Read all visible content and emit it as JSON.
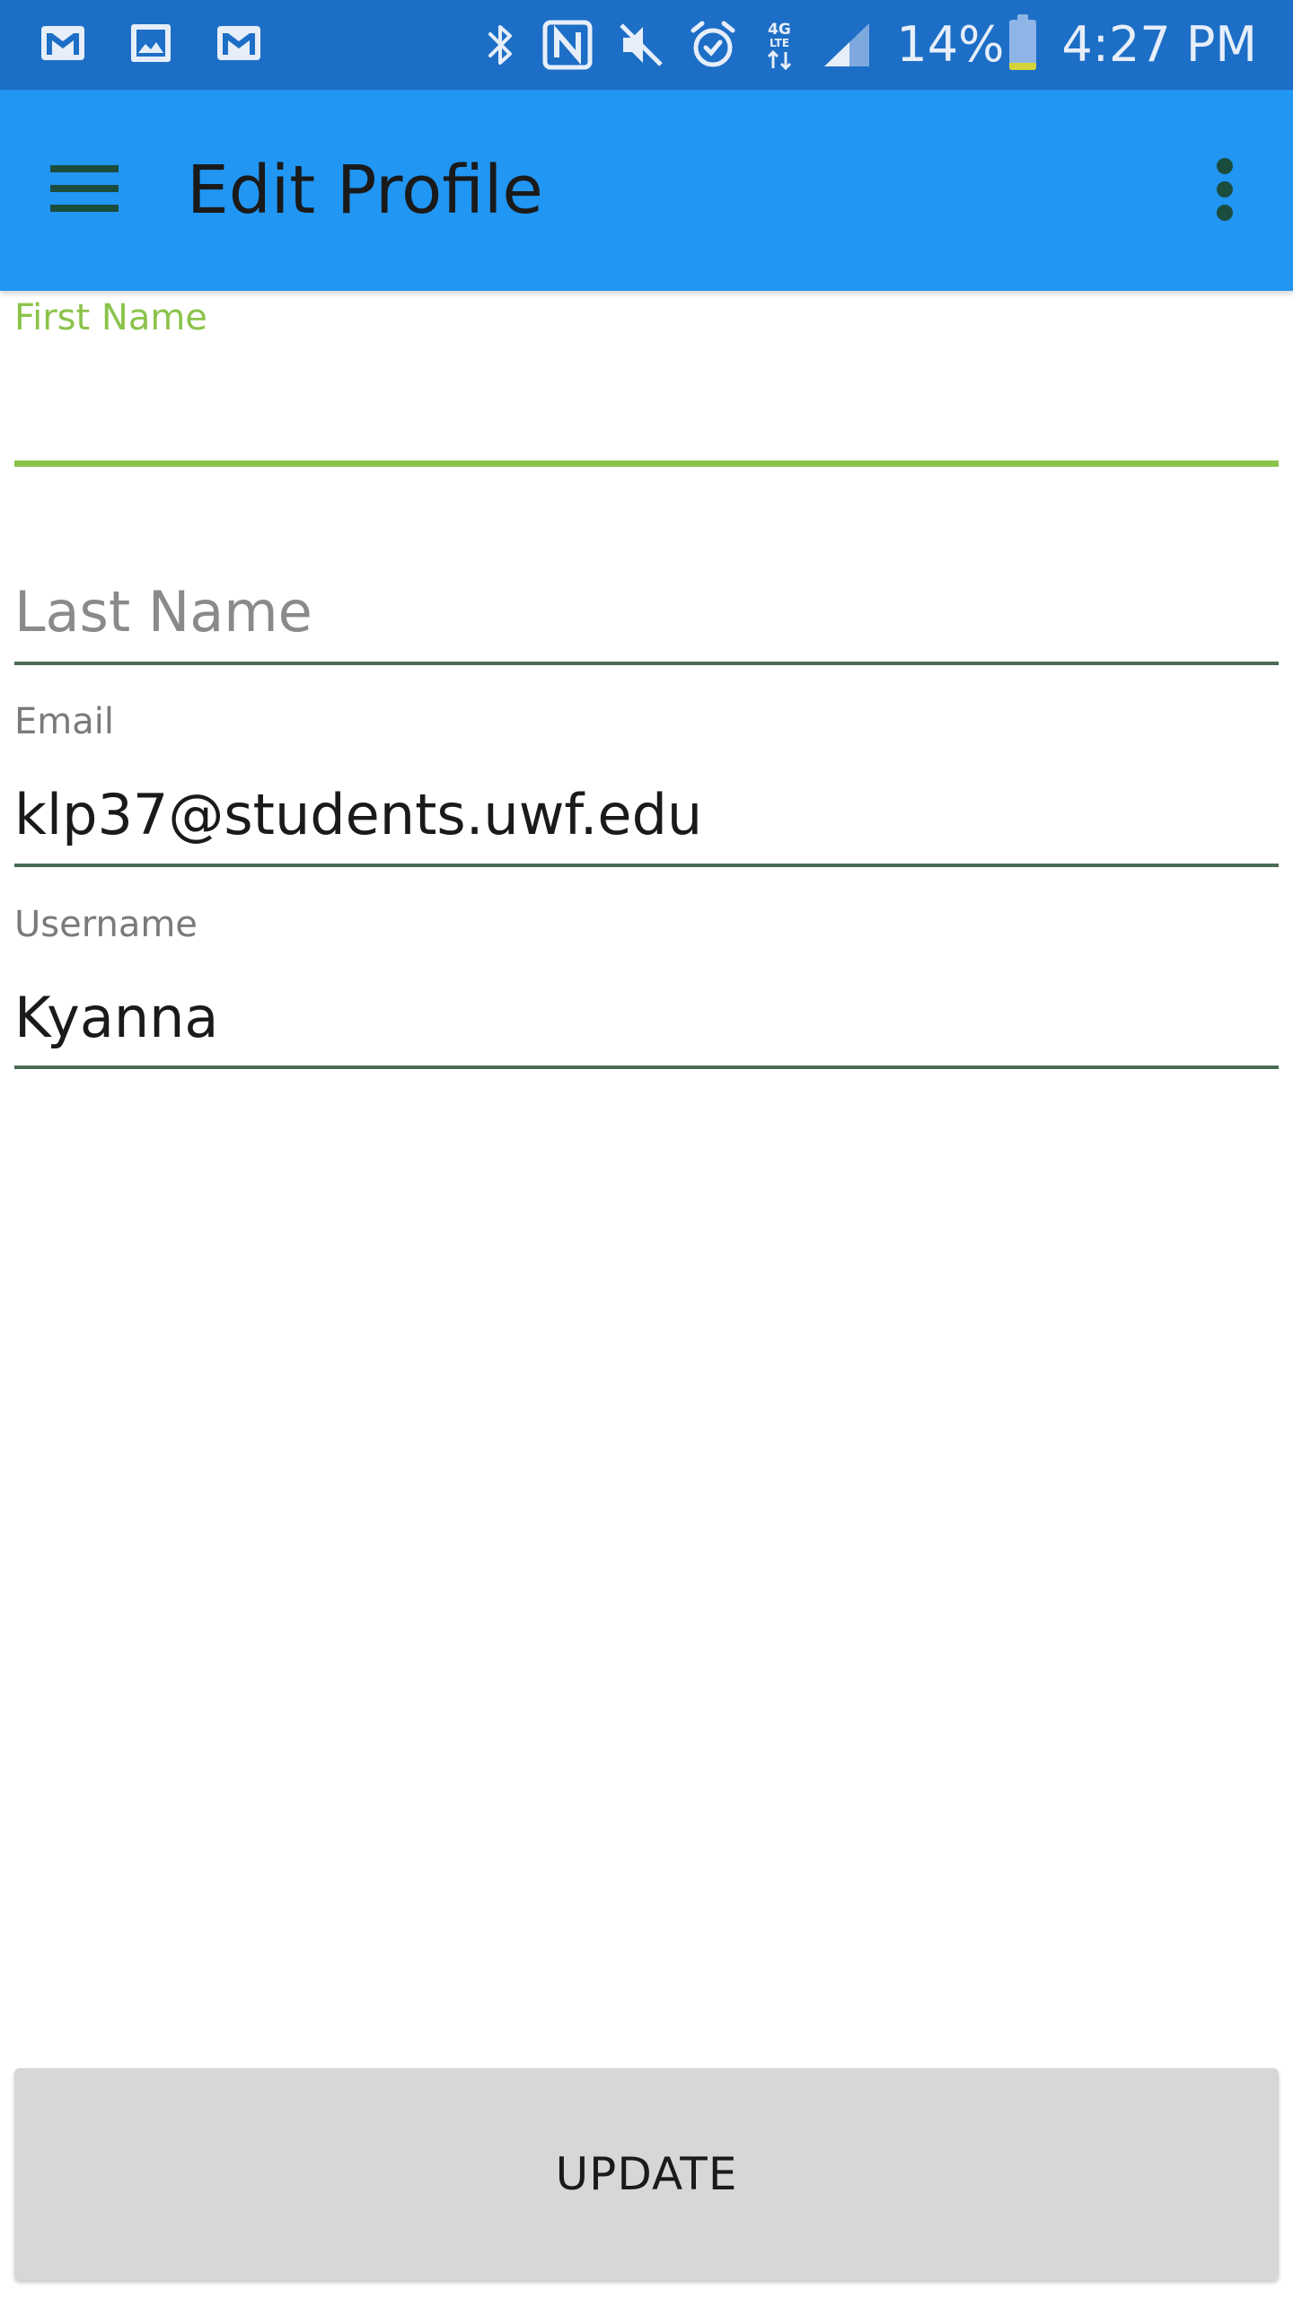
{
  "status_bar": {
    "left_icons": [
      "gmail-icon",
      "gallery-icon",
      "gmail-icon"
    ],
    "right_icons": [
      "bluetooth-icon",
      "nfc-icon",
      "mute-icon",
      "alarm-icon",
      "4g-lte-icon",
      "signal-icon"
    ],
    "battery_percent": "14%",
    "battery_level": 0.14,
    "time": "4:27 PM"
  },
  "app_bar": {
    "title": "Edit Profile",
    "menu_icon": "hamburger-menu-icon",
    "overflow_icon": "more-vert-icon",
    "background_color": "#2196f3"
  },
  "form": {
    "first_name": {
      "label": "First Name",
      "value": ""
    },
    "last_name": {
      "placeholder": "Last Name",
      "value": ""
    },
    "email": {
      "label": "Email",
      "value": "klp37@students.uwf.edu"
    },
    "username": {
      "label": "Username",
      "value": "Kyanna"
    },
    "accent_color": "#8bc34a"
  },
  "update_button": {
    "label": "UPDATE"
  }
}
